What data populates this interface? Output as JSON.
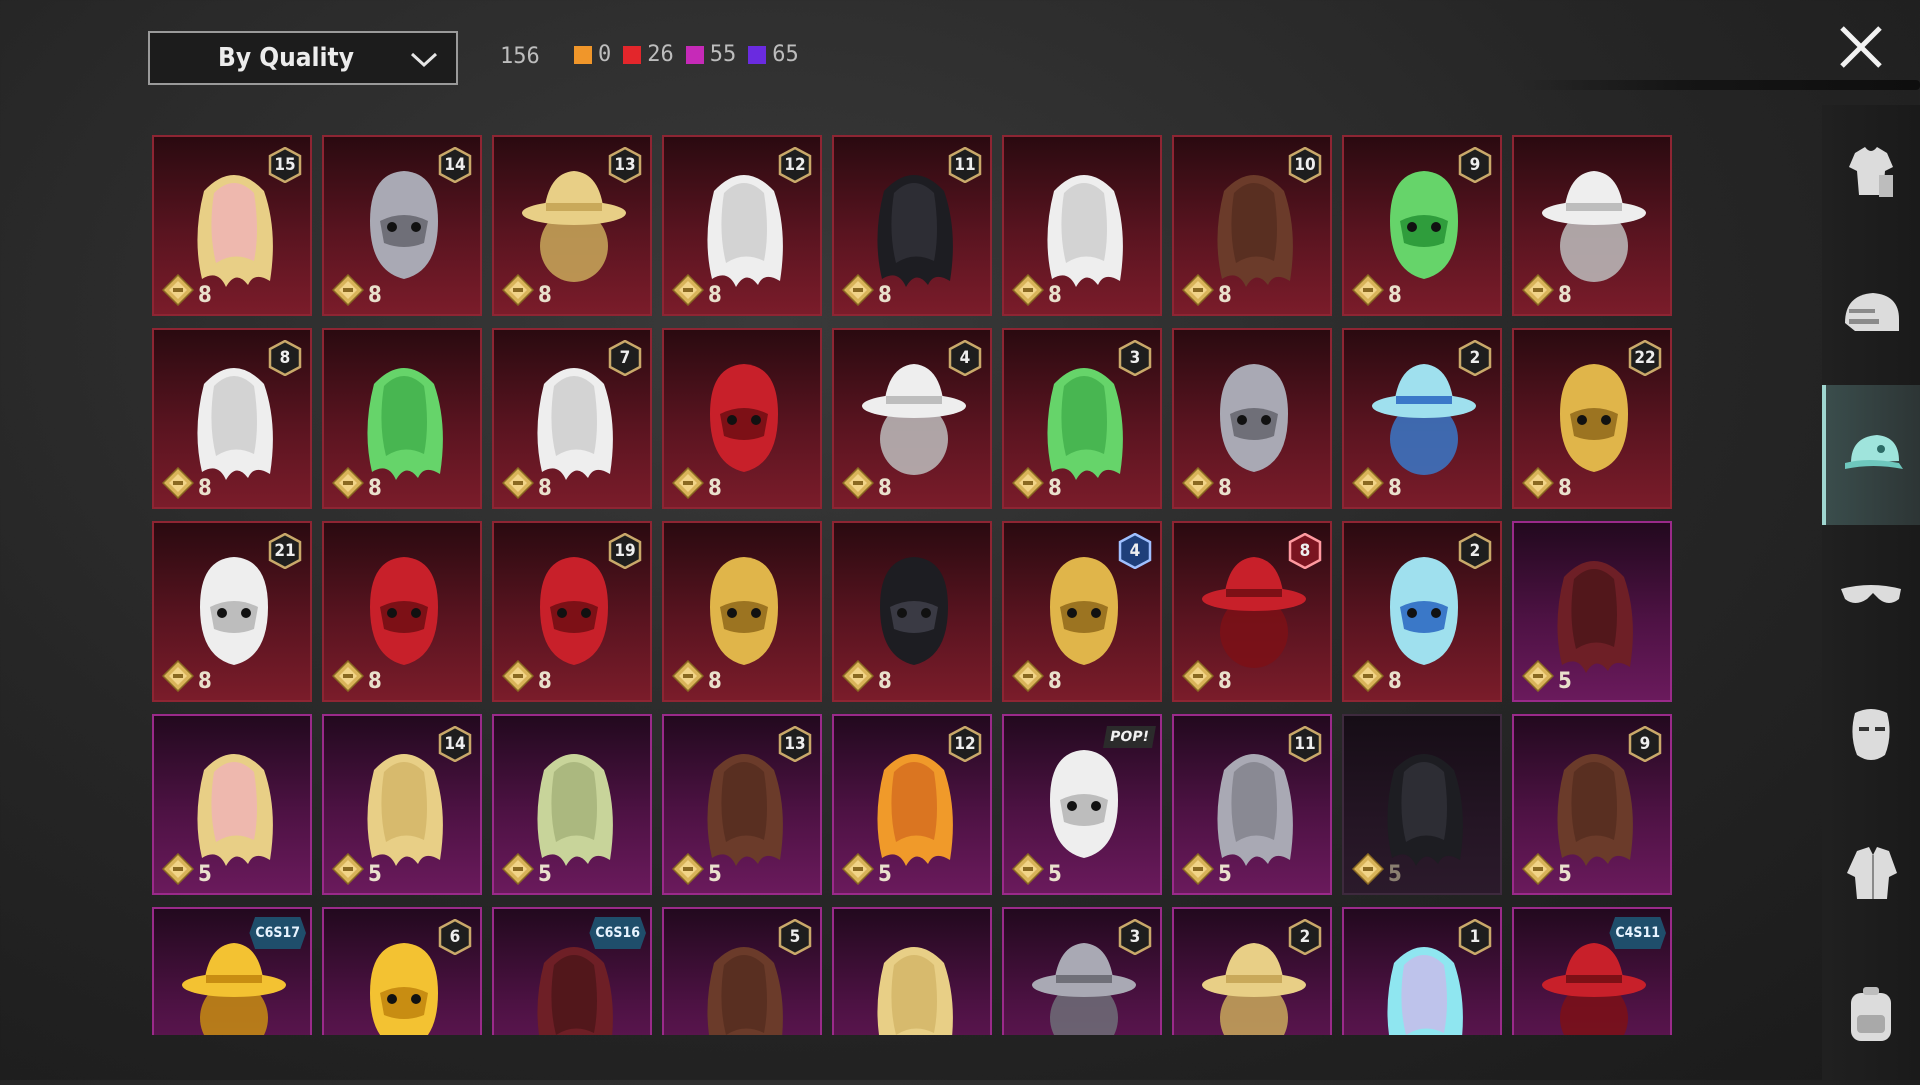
{
  "sort": {
    "label": "By Quality"
  },
  "counts": {
    "total": "156",
    "by_quality": [
      {
        "color": "#f0962a",
        "value": "0"
      },
      {
        "color": "#e3262b",
        "value": "26"
      },
      {
        "color": "#c62ab8",
        "value": "55"
      },
      {
        "color": "#6a2be0",
        "value": "65"
      }
    ]
  },
  "sidebar": {
    "categories": [
      {
        "icon": "outfit-icon",
        "active": false
      },
      {
        "icon": "helmet-icon",
        "active": false
      },
      {
        "icon": "cap-icon",
        "active": true
      },
      {
        "icon": "glasses-icon",
        "active": false
      },
      {
        "icon": "mask-icon",
        "active": false
      },
      {
        "icon": "jacket-icon",
        "active": false
      },
      {
        "icon": "backpack-icon",
        "active": false
      }
    ]
  },
  "items": [
    {
      "quality": "red",
      "art": "blonde-pink-hair-with-bow",
      "badge": "15",
      "cost": "8"
    },
    {
      "quality": "red",
      "art": "cat-ear-mask-hair",
      "badge": "14",
      "cost": "8"
    },
    {
      "quality": "red",
      "art": "hat-with-blonde-hair",
      "badge": "13",
      "cost": "8"
    },
    {
      "quality": "red",
      "art": "white-hair-with-antlers",
      "badge": "12",
      "cost": "8"
    },
    {
      "quality": "red",
      "art": "black-streaked-hair",
      "badge": "11",
      "cost": "8"
    },
    {
      "quality": "red",
      "art": "white-long-hair",
      "badge": "",
      "cost": "8"
    },
    {
      "quality": "red",
      "art": "brown-braided-hair",
      "badge": "10",
      "cost": "8"
    },
    {
      "quality": "red",
      "art": "green-zombie-head",
      "badge": "9",
      "cost": "8"
    },
    {
      "quality": "red",
      "art": "white-cowboy-hat",
      "badge": "",
      "cost": "8"
    },
    {
      "quality": "red",
      "art": "platinum-hair-with-wing",
      "badge": "8",
      "cost": "8"
    },
    {
      "quality": "red",
      "art": "green-long-hair",
      "badge": "",
      "cost": "8"
    },
    {
      "quality": "red",
      "art": "white-long-hair-2",
      "badge": "7",
      "cost": "8"
    },
    {
      "quality": "red",
      "art": "red-helmet",
      "badge": "",
      "cost": "8"
    },
    {
      "quality": "red",
      "art": "snowman-top-hat",
      "badge": "4",
      "cost": "8"
    },
    {
      "quality": "red",
      "art": "joker-green-hair",
      "badge": "3",
      "cost": "8"
    },
    {
      "quality": "red",
      "art": "dragon-helmet",
      "badge": "",
      "cost": "8"
    },
    {
      "quality": "red",
      "art": "icy-bucket-hat",
      "badge": "2",
      "cost": "8"
    },
    {
      "quality": "red",
      "art": "golden-pharaoh-headdress",
      "badge": "22",
      "cost": "8"
    },
    {
      "quality": "red",
      "art": "oni-mask-white-hair",
      "badge": "21",
      "cost": "8"
    },
    {
      "quality": "red",
      "art": "black-red-horned-mask",
      "badge": "",
      "cost": "8"
    },
    {
      "quality": "red",
      "art": "dark-armored-helmet",
      "badge": "19",
      "cost": "8"
    },
    {
      "quality": "red",
      "art": "red-gold-helmet",
      "badge": "",
      "cost": "8"
    },
    {
      "quality": "red",
      "art": "black-cat-helmet",
      "badge": "",
      "cost": "8"
    },
    {
      "quality": "red",
      "art": "gold-purple-knight-helmet",
      "badge": "4",
      "badge_style": "blue",
      "cost": "8"
    },
    {
      "quality": "red",
      "art": "red-fedora-mask",
      "badge": "8",
      "badge_style": "red",
      "cost": "8"
    },
    {
      "quality": "red",
      "art": "blue-spiked-helmet",
      "badge": "2",
      "cost": "8"
    },
    {
      "quality": "purple",
      "art": "dark-red-bob-hair",
      "badge": "",
      "cost": "5"
    },
    {
      "quality": "purple",
      "art": "blonde-ponytail-pink-bow",
      "badge": "",
      "cost": "5"
    },
    {
      "quality": "purple",
      "art": "blonde-hair-flower",
      "badge": "14",
      "cost": "5"
    },
    {
      "quality": "purple",
      "art": "sage-long-hair",
      "badge": "",
      "cost": "5"
    },
    {
      "quality": "purple",
      "art": "brown-hair-goggles",
      "badge": "13",
      "cost": "5"
    },
    {
      "quality": "purple",
      "art": "orange-flame-hair",
      "badge": "12",
      "cost": "5"
    },
    {
      "quality": "purple",
      "art": "panda-head",
      "logo": "POP!",
      "cost": "5"
    },
    {
      "quality": "purple",
      "art": "flower-crown-grey-hair",
      "badge": "11",
      "cost": "5"
    },
    {
      "quality": "dim",
      "art": "dark-ponytail",
      "badge": "",
      "cost": "5"
    },
    {
      "quality": "purple",
      "art": "brown-long-hair",
      "badge": "9",
      "cost": "5"
    },
    {
      "quality": "purple",
      "art": "yellow-visor-cap",
      "season": "C6S17",
      "cost": ""
    },
    {
      "quality": "purple",
      "art": "yellow-black-mask",
      "badge": "6",
      "cost": ""
    },
    {
      "quality": "purple",
      "art": "red-hair",
      "season": "C6S16",
      "cost": ""
    },
    {
      "quality": "purple",
      "art": "brown-pigtails",
      "badge": "5",
      "cost": ""
    },
    {
      "quality": "purple",
      "art": "blonde-curls",
      "badge": "",
      "cost": ""
    },
    {
      "quality": "purple",
      "art": "jester-hat",
      "badge": "3",
      "cost": ""
    },
    {
      "quality": "purple",
      "art": "blonde-white-cap",
      "badge": "2",
      "cost": ""
    },
    {
      "quality": "purple",
      "art": "cyan-pink-bun",
      "badge": "1",
      "cost": ""
    },
    {
      "quality": "purple",
      "art": "red-baseball-cap",
      "season": "C4S11",
      "cost": ""
    }
  ]
}
